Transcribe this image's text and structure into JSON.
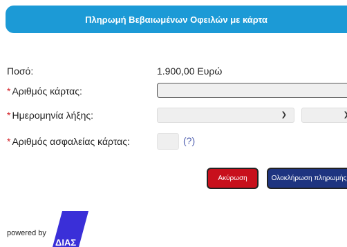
{
  "header": {
    "title": "Πληρωμή Βεβαιωμένων Οφειλών με κάρτα"
  },
  "form": {
    "amount_label": "Ποσό:",
    "amount_value": "1.900,00 Ευρώ",
    "required_mark": "*",
    "card_number_label": "Αριθμός κάρτας:",
    "card_number_value": "",
    "expiry_label": "Ημερομηνία λήξης:",
    "expiry_month_value": "",
    "expiry_year_value": "",
    "cvv_label": "Αριθμός ασφαλείας κάρτας:",
    "cvv_value": "",
    "cvv_help": "(?)"
  },
  "buttons": {
    "cancel_label": "Ακύρωση",
    "complete_label": "Ολοκλήρωση πληρωμής"
  },
  "footer": {
    "powered_by": "powered by",
    "logo_text": "ΔΙΑΣ"
  },
  "colors": {
    "header_bg": "#1c9ad6",
    "required": "#d31f26",
    "cancel_bg": "#c8101c",
    "complete_bg": "#1e3480",
    "logo": "#3a2fd8"
  },
  "icons": {
    "chevron": "chevron-down-icon"
  }
}
